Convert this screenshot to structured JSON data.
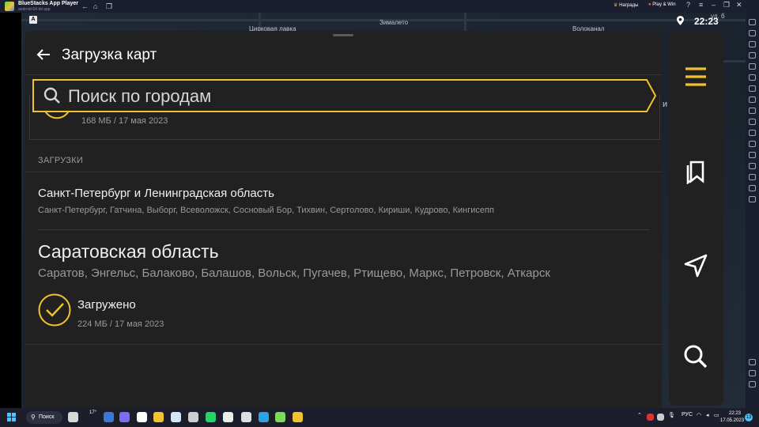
{
  "window": {
    "title": "BlueStacks App Player",
    "subtitle": "android-64-bit app",
    "rewards_label": "Награды",
    "playwin_label": "Play & Win"
  },
  "status_bar": {
    "time": "22:23"
  },
  "map_labels": {
    "street_1": "Цирковая лавка",
    "street_2": "Зималето",
    "street_3": "Волоканал",
    "edge_1": "ул. б",
    "edge_2": "и"
  },
  "panel": {
    "title": "Загрузка карт",
    "search_placeholder": "Поиск по городам",
    "previous_item_meta": "168 МБ / 17 мая 2023",
    "section_header": "ЗАГРУЗКИ",
    "items": [
      {
        "title": "Санкт-Петербург и Ленинградская область",
        "cities": "Санкт-Петербург, Гатчина, Выборг, Всеволожск, Сосновый Бор, Тихвин, Сертолово, Кириши, Кудрово, Кингисепп"
      },
      {
        "title": "Саратовская область",
        "cities": "Саратов, Энгельс, Балаково, Балашов, Вольск, Пугачев, Ртищево, Маркс, Петровск, Аткарск",
        "status": "Загружено",
        "meta": "224 МБ / 17 мая 2023"
      }
    ]
  },
  "nav": [
    "menu-icon",
    "bookmarks-icon",
    "navigation-icon",
    "search-icon"
  ],
  "taskbar": {
    "search_label": "Поиск",
    "weather": "17°",
    "lang": "РУС",
    "time": "22:23",
    "date": "17.05.2023",
    "notif_count": "13"
  },
  "colors": {
    "accent": "#f2c12e",
    "panel": "#212121"
  }
}
